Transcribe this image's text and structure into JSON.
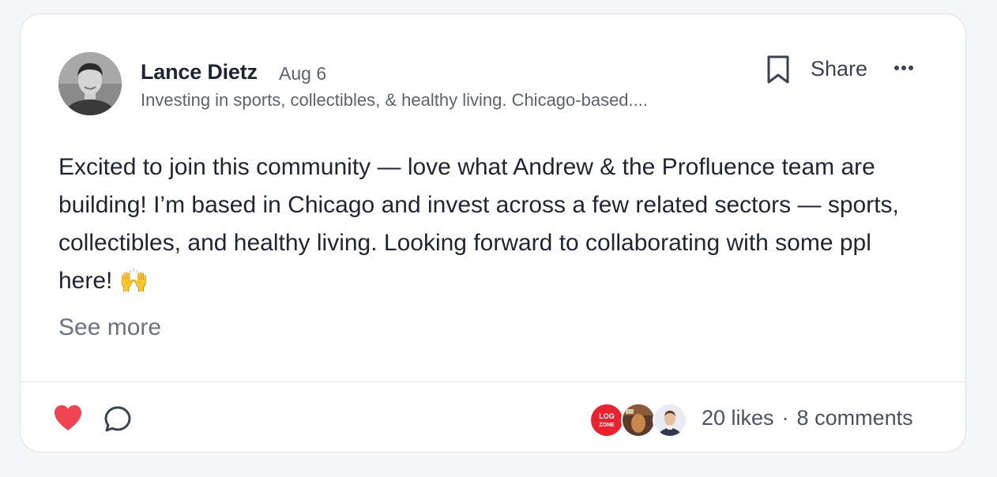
{
  "post": {
    "author_name": "Lance Dietz",
    "date": "Aug 6",
    "author_bio": "Investing in sports, collectibles, & healthy living. Chicago-based....",
    "body": "Excited to join this community — love what Andrew & the Profluence team are building! I’m based in Chicago and invest across a few related sectors — sports, collectibles, and healthy living. Looking forward to collaborating with some ppl here! 🙌",
    "see_more_label": "See more"
  },
  "actions": {
    "share_label": "Share",
    "bookmark_icon": "bookmark-icon",
    "more_icon": "more-horizontal-icon"
  },
  "footer": {
    "likes_label": "20 likes",
    "separator": "·",
    "comments_label": "8 comments",
    "like_icon": "heart-icon",
    "comment_icon": "comment-bubble-icon",
    "liker_avatars": [
      "liker-avatar-logo",
      "liker-avatar-photo",
      "liker-avatar-person"
    ],
    "liker_logo_text": "LOG ZONE"
  },
  "colors": {
    "heart": "#f04452",
    "text_primary": "#1f2533",
    "text_secondary": "#5b6270",
    "logo_red": "#e8222e"
  }
}
